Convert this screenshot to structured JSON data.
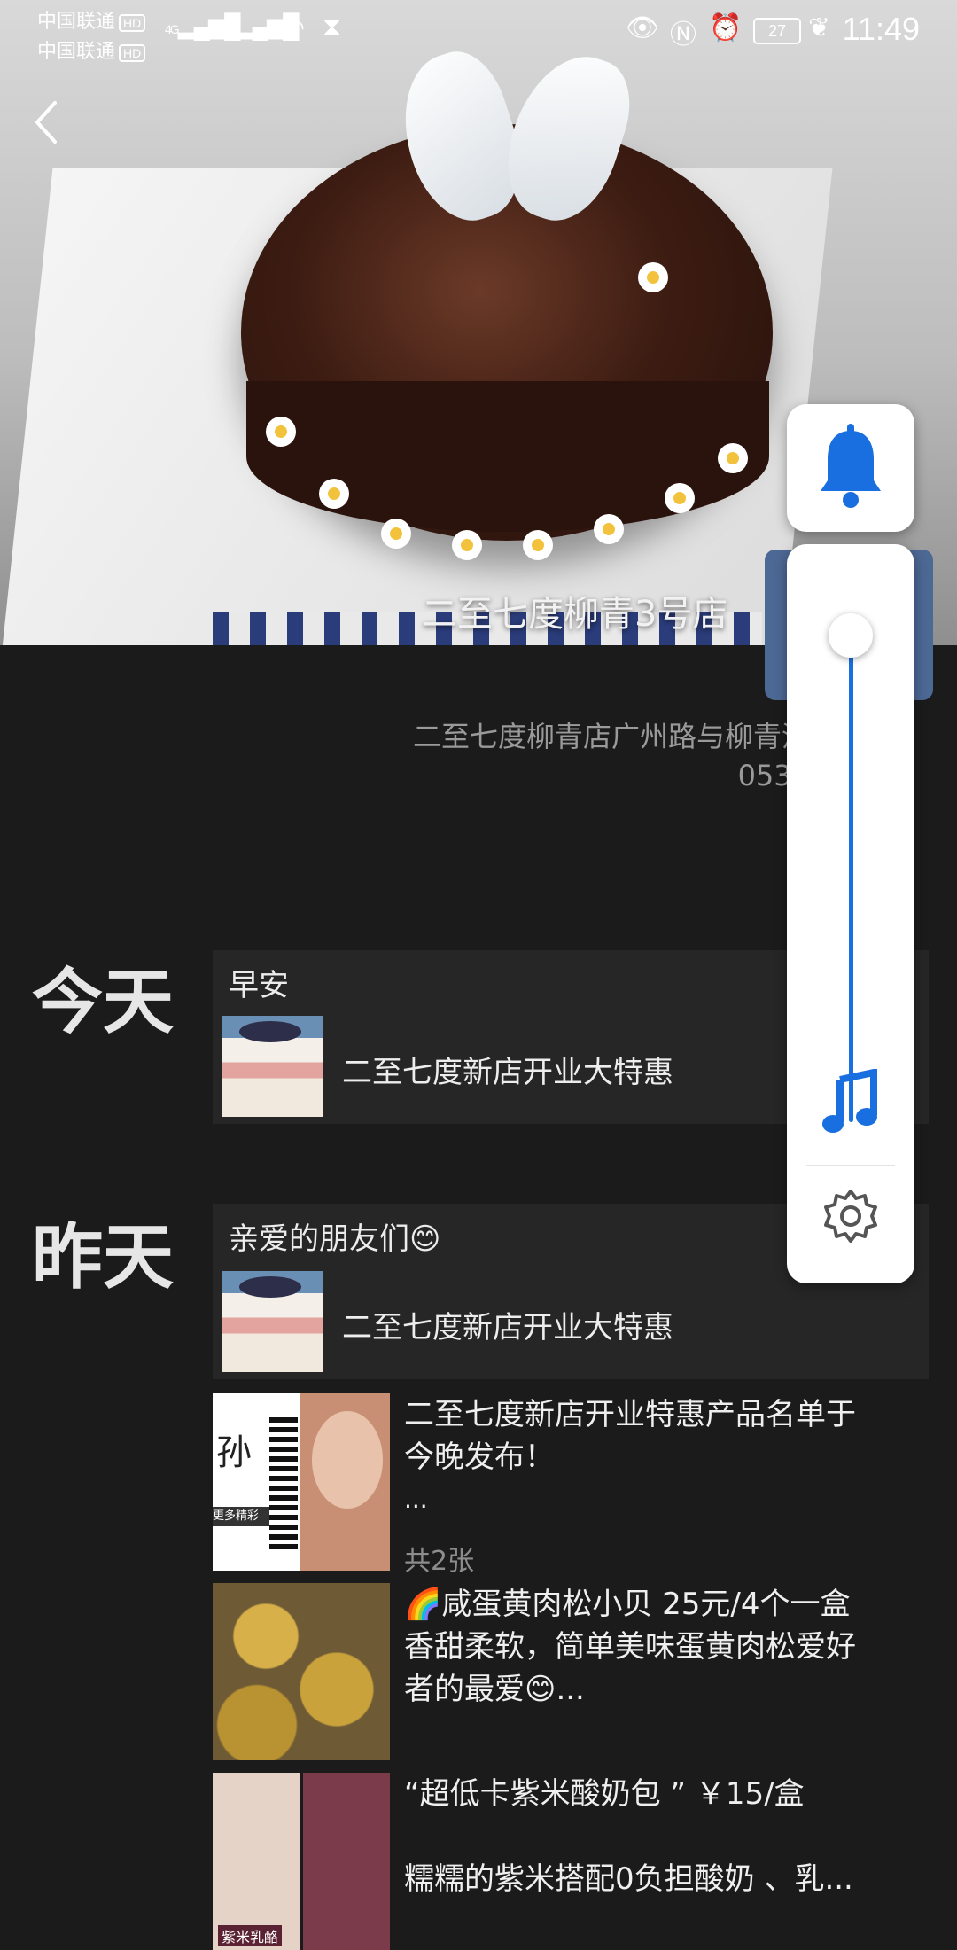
{
  "status_bar": {
    "carrier_1": "中国联通",
    "carrier_2": "中国联通",
    "hd_badge": "HD",
    "network": "4G",
    "battery": "27",
    "time": "11:49"
  },
  "header": {
    "store_title": "二至七度柳青3号店",
    "address": "二至七度柳青店广州路与柳青河",
    "phone": "0539"
  },
  "timeline": {
    "today_label": "今天",
    "yesterday_label": "昨天",
    "today_card": {
      "title": "早安",
      "text": "二至七度新店开业大特惠"
    },
    "yesterday_card": {
      "title": "亲爱的朋友们😊",
      "text": "二至七度新店开业大特惠"
    },
    "posts": [
      {
        "line1": "二至七度新店开业特惠产品名单于",
        "line2": "今晚发布！",
        "line3": "...",
        "meta": "共2张",
        "img_text_1": "孙",
        "img_text_2": "更多精彩"
      },
      {
        "line1": "🌈咸蛋黄肉松小贝 25元/4个一盒",
        "line2": "香甜柔软，简单美味蛋黄肉松爱好",
        "line3": "者的最爱😊..."
      },
      {
        "line1": "“超低卡紫米酸奶包 ” ￥15/盒",
        "line2": "",
        "line3": "糯糯的紫米搭配0负担酸奶 、乳...",
        "img_text_1": "紫米乳酪"
      }
    ]
  },
  "volume_panel": {
    "level": 0.98,
    "icons": [
      "bell-icon",
      "music-note-icon",
      "gear-icon"
    ],
    "accent_color": "#1a6fe0"
  }
}
